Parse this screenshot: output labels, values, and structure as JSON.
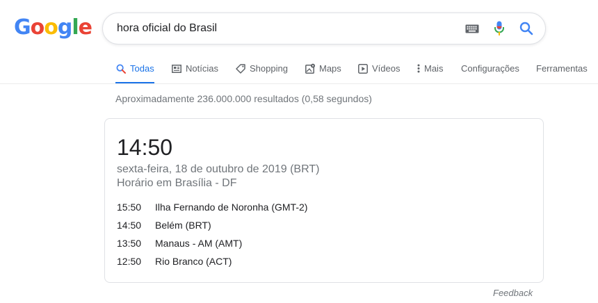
{
  "logo": {
    "letters": [
      "G",
      "o",
      "o",
      "g",
      "l",
      "e"
    ],
    "colors": [
      "#4285f4",
      "#ea4335",
      "#fbbc05",
      "#4285f4",
      "#34a853",
      "#ea4335"
    ]
  },
  "search": {
    "query": "hora oficial do Brasil",
    "keyboard_icon": "keyboard-icon",
    "mic_icon": "microphone-icon",
    "search_icon": "search-icon"
  },
  "tabs": [
    {
      "label": "Todas",
      "icon": "search-icon",
      "active": true
    },
    {
      "label": "Notícias",
      "icon": "news-icon",
      "active": false
    },
    {
      "label": "Shopping",
      "icon": "tag-icon",
      "active": false
    },
    {
      "label": "Maps",
      "icon": "map-icon",
      "active": false
    },
    {
      "label": "Vídeos",
      "icon": "video-icon",
      "active": false
    },
    {
      "label": "Mais",
      "icon": "more-vert-icon",
      "active": false
    },
    {
      "label": "Configurações",
      "icon": "",
      "active": false
    },
    {
      "label": "Ferramentas",
      "icon": "",
      "active": false
    }
  ],
  "result_stats": "Aproximadamente 236.000.000 resultados (0,58 segundos)",
  "card": {
    "time": "14:50",
    "date": "sexta-feira, 18 de outubro de 2019 (BRT)",
    "place": "Horário em Brasília - DF",
    "zones": [
      {
        "time": "15:50",
        "name": "Ilha Fernando de Noronha (GMT-2)"
      },
      {
        "time": "14:50",
        "name": "Belém (BRT)"
      },
      {
        "time": "13:50",
        "name": "Manaus - AM (AMT)"
      },
      {
        "time": "12:50",
        "name": "Rio Branco (ACT)"
      }
    ]
  },
  "feedback": "Feedback",
  "colors": {
    "accent": "#1a73e8",
    "muted": "#70757a"
  }
}
